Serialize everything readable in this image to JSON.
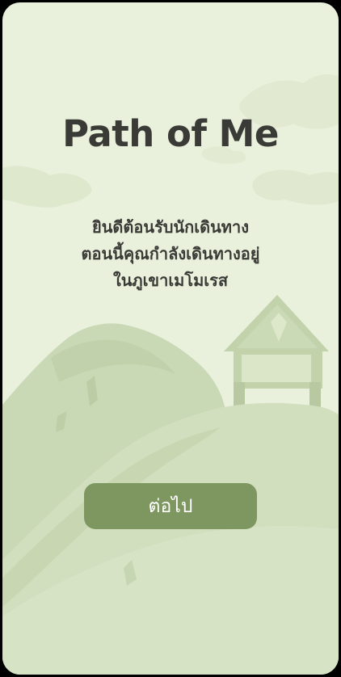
{
  "app": {
    "title": "Path of Me"
  },
  "welcome": {
    "lines": [
      "ยินดีต้อนรับนักเดินทาง",
      "ตอนนี้คุณกำลังเดินทางอยู่",
      "ในภูเขาเมโมเรส"
    ]
  },
  "actions": {
    "next_label": "ต่อไป"
  },
  "colors": {
    "background": "#e9f0dc",
    "button": "#7e9761",
    "text": "#3a3b36"
  }
}
